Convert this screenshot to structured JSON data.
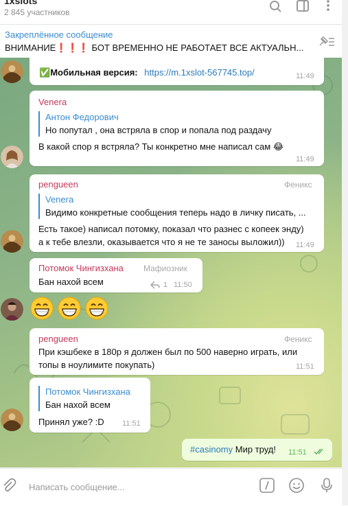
{
  "header": {
    "title": "1xslots",
    "members": "2 845 участников"
  },
  "pinned": {
    "title": "Закреплённое сообщение",
    "text": "ВНИМАНИЕ❗❗❗ БОТ ВРЕМЕННО НЕ РАБОТАЕТ ВСЕ АКТУАЛЬН..."
  },
  "messages": {
    "m1": {
      "prefix": "✅",
      "label": "Мобильная версия:",
      "link": "https://m.1xslot-567745.top/",
      "time": "11:49"
    },
    "m2": {
      "sender": "Venera",
      "quote_name": "Антон Федорович",
      "quote_text": "Но попутал , она встряла в спор и попала под раздачу",
      "text": "В какой спор я встряла? Ты конкретно мне написал сам 😂",
      "time": "11:49"
    },
    "m3": {
      "sender": "pengueen",
      "role": "Феникс",
      "quote_name": "Venera",
      "quote_text": "Видимо конкретные сообщения теперь надо в личку писать, ...",
      "line1": "Есть такое) написал потомку, показал что разнес с копеек энду)",
      "line2": "а к тебе влезли, оказывается что я не те заносы выложил))",
      "time": "11:49"
    },
    "m4": {
      "sender": "Потомок Чингизхана",
      "role": "Мафиозник",
      "text": "Бан нахой всем",
      "replies": "1",
      "time": "11:50"
    },
    "m5": {
      "emojis": "😁😁😁"
    },
    "m6": {
      "sender": "pengueen",
      "role": "Феникс",
      "line1": "При кэшбеке в 180р я должен был по 500 наверно играть, или",
      "line2": "топы в ноулимите покупать)",
      "time": "11:51"
    },
    "m7": {
      "quote_name": "Потомок Чингизхана",
      "quote_text": "Бан нахой всем",
      "text": "Принял уже? :D",
      "time": "11:51"
    },
    "m8": {
      "hashtag": "#casinomy",
      "text": " Мир труд!",
      "time": "11:51"
    }
  },
  "composer": {
    "placeholder": "Написать сообщение..."
  },
  "colors": {
    "accent": "#3a8cd0",
    "venera": "#c0395a",
    "pengueen": "#c0395a",
    "potomok": "#c0395a",
    "outgoing": "#effdde"
  },
  "icons": [
    "search-icon",
    "sidebar-toggle-icon",
    "more-vertical-icon",
    "unpin-icon",
    "attach-icon",
    "command-icon",
    "emoji-icon",
    "microphone-icon",
    "double-check-icon",
    "reply-icon"
  ]
}
